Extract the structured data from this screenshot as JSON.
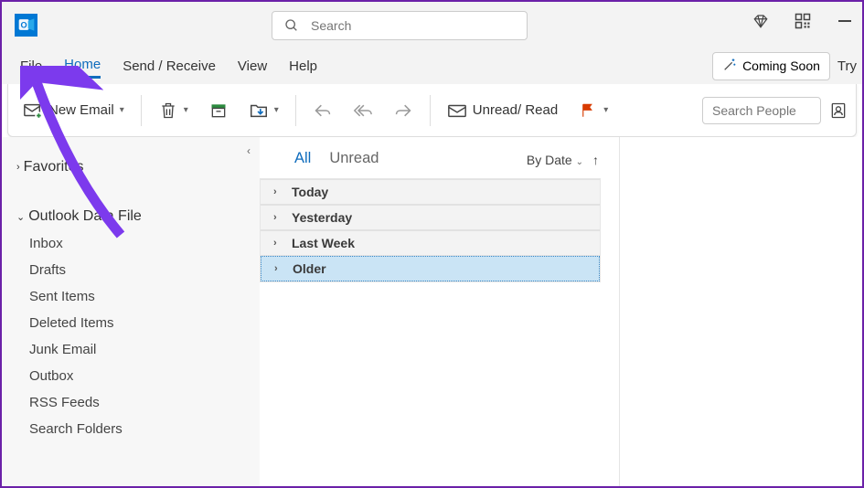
{
  "titlebar": {
    "search_placeholder": "Search"
  },
  "menu": {
    "tabs": [
      "File",
      "Home",
      "Send / Receive",
      "View",
      "Help"
    ],
    "active_index": 1,
    "coming_soon": "Coming Soon",
    "try": "Try"
  },
  "ribbon": {
    "new_email": "New Email",
    "unread_read": "Unread/ Read",
    "search_people_placeholder": "Search People"
  },
  "sidebar": {
    "favorites": "Favorites",
    "datafile": "Outlook Data File",
    "folders": [
      "Inbox",
      "Drafts",
      "Sent Items",
      "Deleted Items",
      "Junk Email",
      "Outbox",
      "RSS Feeds",
      "Search Folders"
    ]
  },
  "list": {
    "tabs": [
      "All",
      "Unread"
    ],
    "active_index": 0,
    "sort": "By Date",
    "groups": [
      "Today",
      "Yesterday",
      "Last Week",
      "Older"
    ],
    "selected_index": 3
  }
}
